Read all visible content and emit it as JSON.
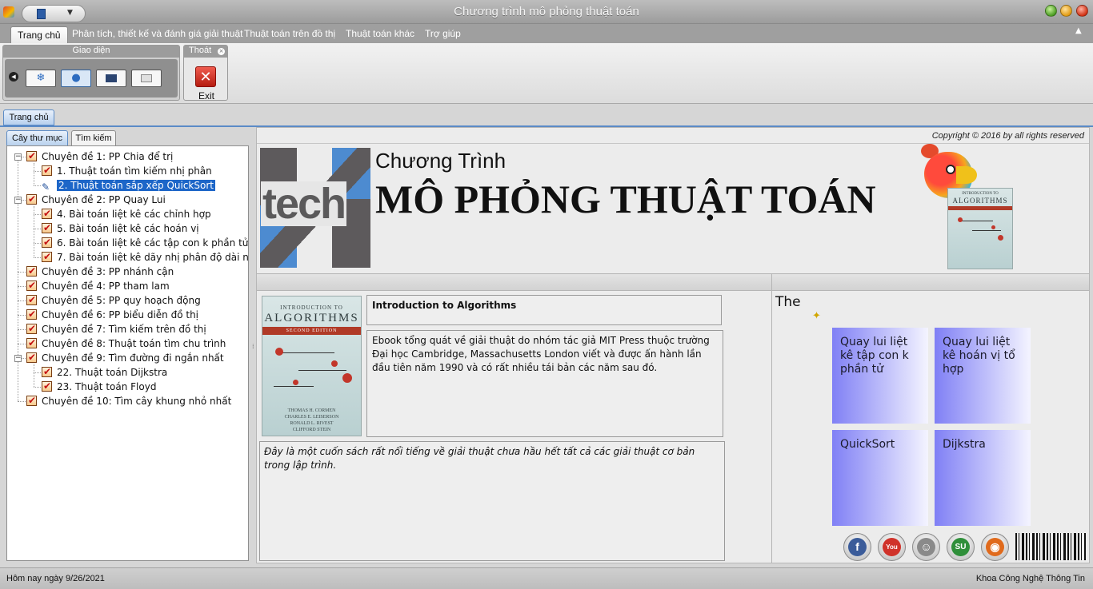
{
  "window": {
    "title": "Chương trình mô phỏng thuật toán"
  },
  "ribbon": {
    "tabs": [
      {
        "label": "Trang chủ"
      },
      {
        "label": "Phân tích, thiết kế và đánh giá giải thuật"
      },
      {
        "label": "Thuật toán trên đồ thị"
      },
      {
        "label": "Thuật toán khác"
      },
      {
        "label": "Trợ giúp"
      }
    ],
    "group_theme": {
      "title": "Giao diện"
    },
    "group_exit": {
      "title": "Thoát",
      "button_label": "Exit"
    }
  },
  "document_tab": {
    "label": "Trang chủ"
  },
  "sidebar": {
    "tabs": [
      {
        "label": "Cây thư mục"
      },
      {
        "label": "Tìm kiếm"
      }
    ],
    "tree": [
      {
        "label": "Chuyên đề 1: PP Chia để trị",
        "level": 0
      },
      {
        "label": "1. Thuật toán tìm kiếm nhị phân",
        "level": 1
      },
      {
        "label": "2. Thuật toán sắp xếp QuickSort",
        "level": 1,
        "selected": true
      },
      {
        "label": "Chuyên đề 2: PP Quay Lui",
        "level": 0
      },
      {
        "label": "4. Bài toán liệt kê các chỉnh hợp",
        "level": 1
      },
      {
        "label": "5. Bài toán liệt kê các hoán vị",
        "level": 1
      },
      {
        "label": "6. Bài toán liệt kê các tập con k phần tử",
        "level": 1
      },
      {
        "label": "7. Bài toán liệt kê dãy nhị phân độ dài n",
        "level": 1
      },
      {
        "label": "Chuyên đề 3: PP nhánh cận",
        "level": 0
      },
      {
        "label": "Chuyên đề 4: PP tham lam",
        "level": 0
      },
      {
        "label": "Chuyên đề 5: PP quy hoạch động",
        "level": 0
      },
      {
        "label": "Chuyên đề 6: PP biểu diễn đồ thị",
        "level": 0
      },
      {
        "label": "Chuyên đề 7: Tìm kiếm trên đồ thị",
        "level": 0
      },
      {
        "label": "Chuyên đề 8: Thuật toán tìm chu trình",
        "level": 0
      },
      {
        "label": "Chuyên đề 9: Tìm đường đi ngắn nhất",
        "level": 0
      },
      {
        "label": "22. Thuật toán Dijkstra",
        "level": 1
      },
      {
        "label": "23. Thuật toán Floyd",
        "level": 1
      },
      {
        "label": "Chuyên đề 10: Tìm cây khung nhỏ nhất",
        "level": 0
      }
    ]
  },
  "main": {
    "copyright": "Copyright © 2016 by all rights reserved",
    "logo_text": "tech",
    "banner_line1": "Chương Trình",
    "banner_line2": "MÔ PHỎNG THUẬT TOÁN",
    "book": {
      "cover_top": "INTRODUCTION TO",
      "cover_title": "ALGORITHMS",
      "cover_edition": "SECOND EDITION",
      "cover_authors": [
        "THOMAS H. CORMEN",
        "CHARLES E. LEISERSON",
        "RONALD L. RIVEST",
        "CLIFFORD STEIN"
      ],
      "title": "Introduction to Algorithms",
      "description": "Ebook tổng quát về giải thuật do nhóm tác giả MIT Press thuộc trường Đại học Cambridge, Massachusetts London viết và được ấn hành lần đầu tiên năm 1990 và có rất nhiều tái bản các năm sau đó.",
      "note": "Đây là một cuốn sách rất nổi tiếng về giải thuật chưa hầu hết tất cả các giải thuật cơ bản trong lập trình."
    },
    "the_label": "The",
    "tiles": [
      {
        "label": "Quay lui liệt kê tập con k phần tử"
      },
      {
        "label": "Quay lui liệt kê hoán vị tổ hợp"
      },
      {
        "label": "QuickSort"
      },
      {
        "label": "Dijkstra"
      }
    ],
    "social": [
      {
        "icon": "facebook-icon",
        "glyph": "f",
        "color": "#3b5c9a"
      },
      {
        "icon": "youtube-icon",
        "glyph": "You",
        "color": "#d0322a"
      },
      {
        "icon": "reddit-icon",
        "glyph": "☺",
        "color": "#8a8a8a"
      },
      {
        "icon": "stumbleupon-icon",
        "glyph": "SU",
        "color": "#2f8f3a"
      },
      {
        "icon": "rss-icon",
        "glyph": "◉",
        "color": "#e06a1c"
      }
    ]
  },
  "statusbar": {
    "left": "Hôm nay ngày 9/26/2021",
    "right": "Khoa Công Nghệ Thông Tin"
  },
  "colors": {
    "accent": "#1d66c8",
    "tile_gradient_start": "#8080f5",
    "logo_blue": "#4d8bd0",
    "logo_gray": "#5d5a5c"
  }
}
